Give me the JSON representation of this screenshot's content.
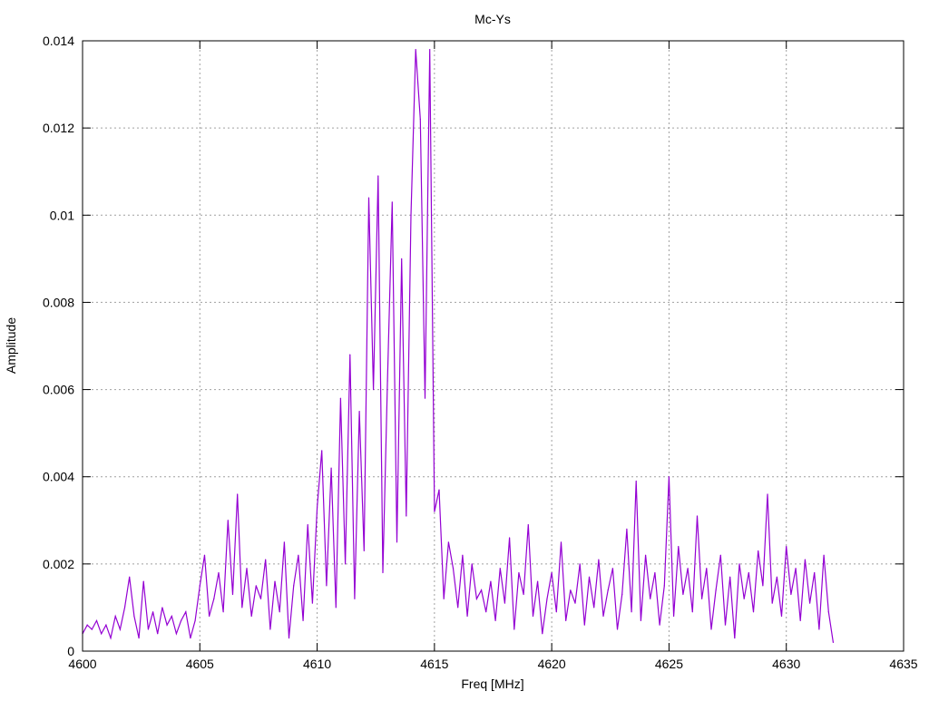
{
  "chart_data": {
    "type": "line",
    "title": "Mc-Ys",
    "xlabel": "Freq [MHz]",
    "ylabel": "Amplitude",
    "xlim": [
      4600,
      4635
    ],
    "ylim": [
      0,
      0.014
    ],
    "xticks": [
      "4600",
      "4605",
      "4610",
      "4615",
      "4620",
      "4625",
      "4630",
      "4635"
    ],
    "yticks": [
      "0",
      "0.002",
      "0.004",
      "0.006",
      "0.008",
      "0.01",
      "0.012",
      "0.014"
    ],
    "grid": true,
    "legend": "none",
    "series": [
      {
        "name": "Mc-Ys",
        "color": "#9400d3",
        "x_start": 4600,
        "x_step": 0.2,
        "values": [
          0.0004,
          0.0006,
          0.0005,
          0.0007,
          0.0004,
          0.0006,
          0.0003,
          0.0008,
          0.0005,
          0.001,
          0.0017,
          0.0008,
          0.0003,
          0.0016,
          0.0005,
          0.0009,
          0.0004,
          0.001,
          0.0006,
          0.0008,
          0.0004,
          0.0007,
          0.0009,
          0.0003,
          0.0007,
          0.0015,
          0.0022,
          0.0008,
          0.0012,
          0.0018,
          0.0009,
          0.003,
          0.0013,
          0.0036,
          0.001,
          0.0019,
          0.0008,
          0.0015,
          0.0012,
          0.0021,
          0.0005,
          0.0016,
          0.0009,
          0.0025,
          0.0003,
          0.0015,
          0.0022,
          0.0007,
          0.0029,
          0.0011,
          0.0033,
          0.0046,
          0.0015,
          0.0042,
          0.001,
          0.0058,
          0.002,
          0.0068,
          0.0012,
          0.0055,
          0.0023,
          0.0104,
          0.006,
          0.0109,
          0.0018,
          0.0062,
          0.0103,
          0.0025,
          0.009,
          0.0031,
          0.01,
          0.0138,
          0.0122,
          0.0058,
          0.0138,
          0.0032,
          0.0037,
          0.0012,
          0.0025,
          0.0019,
          0.001,
          0.0022,
          0.0008,
          0.002,
          0.0012,
          0.0014,
          0.0009,
          0.0016,
          0.0007,
          0.0019,
          0.0011,
          0.0026,
          0.0005,
          0.0018,
          0.0013,
          0.0029,
          0.0008,
          0.0016,
          0.0004,
          0.0012,
          0.0018,
          0.0009,
          0.0025,
          0.0007,
          0.0014,
          0.0011,
          0.002,
          0.0006,
          0.0017,
          0.001,
          0.0021,
          0.0008,
          0.0014,
          0.0019,
          0.0005,
          0.0013,
          0.0028,
          0.0009,
          0.0039,
          0.0007,
          0.0022,
          0.0012,
          0.0018,
          0.0006,
          0.0015,
          0.004,
          0.0008,
          0.0024,
          0.0013,
          0.0019,
          0.0009,
          0.0031,
          0.0012,
          0.0019,
          0.0005,
          0.0014,
          0.0022,
          0.0006,
          0.0017,
          0.0003,
          0.002,
          0.0012,
          0.0018,
          0.0009,
          0.0023,
          0.0015,
          0.0036,
          0.0011,
          0.0017,
          0.0008,
          0.0024,
          0.0013,
          0.0019,
          0.0007,
          0.0021,
          0.0011,
          0.0018,
          0.0005,
          0.0022,
          0.0009,
          0.0002
        ]
      }
    ]
  }
}
